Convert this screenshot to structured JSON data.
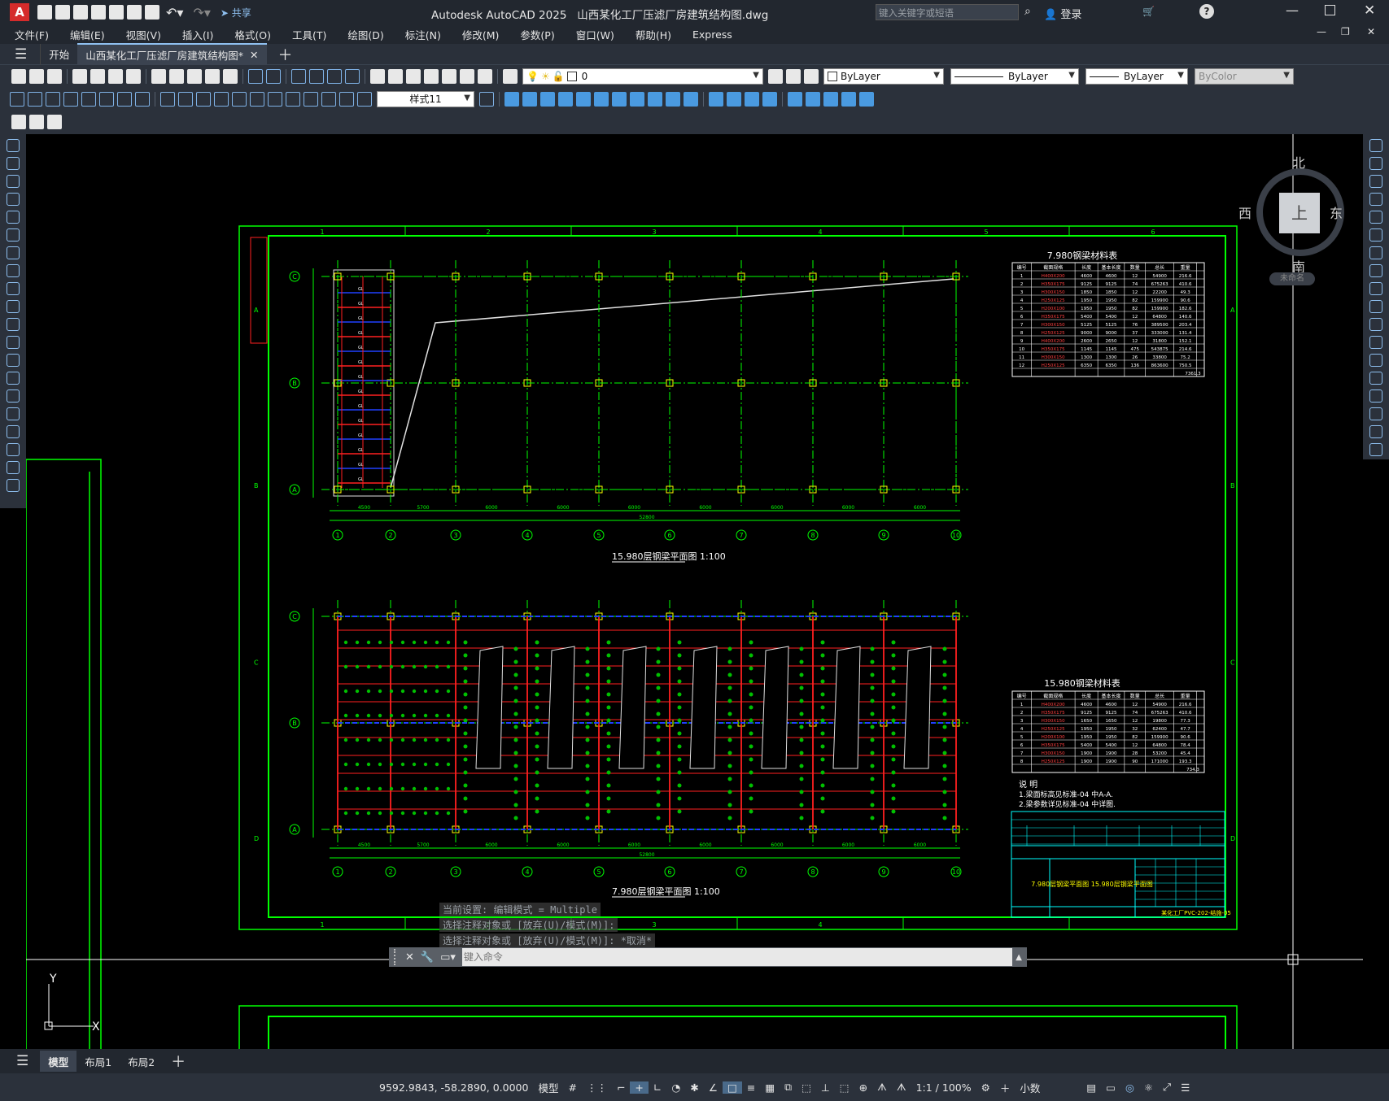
{
  "title_bar": {
    "app_name": "Autodesk AutoCAD 2025",
    "file_name": "山西某化工厂压滤厂房建筑结构图.dwg",
    "share_label": "共享",
    "search_placeholder": "键入关键字或短语",
    "login_label": "登录"
  },
  "menu": [
    "文件(F)",
    "编辑(E)",
    "视图(V)",
    "插入(I)",
    "格式(O)",
    "工具(T)",
    "绘图(D)",
    "标注(N)",
    "修改(M)",
    "参数(P)",
    "窗口(W)",
    "帮助(H)",
    "Express"
  ],
  "file_tabs": {
    "home": "开始",
    "active": "山西某化工厂压滤厂房建筑结构图*"
  },
  "layer": {
    "current": "0"
  },
  "properties": {
    "color": "ByLayer",
    "linetype": "ByLayer",
    "lineweight": "ByLayer",
    "plotstyle": "ByColor"
  },
  "dim_style": "样式11",
  "viewcube": {
    "north": "北",
    "south": "南",
    "east": "东",
    "west": "西",
    "top": "上",
    "wcs": "未命名"
  },
  "drawing": {
    "plan_top_title": "15.980层钢梁平面图",
    "plan_top_scale": "1:100",
    "plan_bottom_title": "7.980层钢梁平面图",
    "plan_bottom_scale": "1:100",
    "table1_title": "7.980钢梁材料表",
    "table2_title": "15.980钢梁材料表",
    "notes_heading": "说 明",
    "note1": "1.梁面标高见标准-04 中A-A.",
    "note2": "2.梁参数详见标准-04 中详图.",
    "grid_numbers": [
      "1",
      "2",
      "3",
      "4",
      "5",
      "6",
      "7",
      "8",
      "9",
      "10"
    ],
    "grid_letters": [
      "C",
      "B",
      "A"
    ],
    "frame_numbers": [
      "1",
      "2",
      "3",
      "4",
      "5",
      "6"
    ],
    "frame_letters": [
      "A",
      "B",
      "C",
      "D"
    ],
    "total_dim": "52800",
    "span_dims": [
      "4500",
      "5700",
      "6000",
      "6000",
      "6000",
      "6000",
      "6000",
      "6000",
      "6000"
    ],
    "table_headers": [
      "编号",
      "截面规格",
      "长度",
      "基本长度",
      "数量",
      "总长",
      "重量"
    ],
    "table1_rows": [
      [
        "1",
        "H400X200",
        "4600",
        "4600",
        "12",
        "54900",
        "216.6"
      ],
      [
        "2",
        "H350X175",
        "9125",
        "9125",
        "74",
        "675263",
        "410.6"
      ],
      [
        "3",
        "H300X150",
        "1850",
        "1850",
        "12",
        "22200",
        "49.3"
      ],
      [
        "4",
        "H250X125",
        "1950",
        "1950",
        "82",
        "159900",
        "90.6"
      ],
      [
        "5",
        "H200X100",
        "1950",
        "1950",
        "82",
        "159900",
        "182.6"
      ],
      [
        "6",
        "H350X175",
        "5400",
        "5400",
        "12",
        "64800",
        "140.6"
      ],
      [
        "7",
        "H300X150",
        "5125",
        "5125",
        "76",
        "389500",
        "203.4"
      ],
      [
        "8",
        "H250X125",
        "9000",
        "9000",
        "37",
        "333000",
        "131.4"
      ],
      [
        "9",
        "H400X200",
        "2600",
        "2650",
        "12",
        "31800",
        "152.1"
      ],
      [
        "10",
        "H350X175",
        "1145",
        "1145",
        "475",
        "543875",
        "214.6"
      ],
      [
        "11",
        "H300X150",
        "1300",
        "1300",
        "26",
        "33800",
        "75.2"
      ],
      [
        "12",
        "H250X125",
        "6350",
        "6350",
        "136",
        "863600",
        "750.5"
      ]
    ],
    "table2_rows": [
      [
        "1",
        "H400X200",
        "4600",
        "4600",
        "12",
        "54900",
        "216.6"
      ],
      [
        "2",
        "H350X175",
        "9125",
        "9125",
        "74",
        "675263",
        "410.6"
      ],
      [
        "3",
        "H300X150",
        "1650",
        "1650",
        "12",
        "19800",
        "77.3"
      ],
      [
        "4",
        "H250X125",
        "1950",
        "1950",
        "32",
        "62400",
        "47.7"
      ],
      [
        "5",
        "H200X100",
        "1950",
        "1950",
        "82",
        "159900",
        "90.6"
      ],
      [
        "6",
        "H350X175",
        "5400",
        "5400",
        "12",
        "64800",
        "78.4"
      ],
      [
        "7",
        "H300X150",
        "1900",
        "1900",
        "28",
        "53200",
        "45.4"
      ],
      [
        "8",
        "H250X125",
        "1900",
        "1900",
        "90",
        "171000",
        "193.3"
      ]
    ],
    "table1_total": "7361.3",
    "table2_total": "734.3",
    "titleblock_drawing_name": "7.980层钢梁平面图 15.980层钢梁平面图",
    "titleblock_number": "某化工厂PVC-202-结施-05"
  },
  "command_history": [
    "当前设置: 编辑模式 = Multiple",
    "选择注释对象或 [放弃(U)/模式(M)]:",
    "选择注释对象或 [放弃(U)/模式(M)]: *取消*"
  ],
  "command_placeholder": "键入命令",
  "layout_tabs": [
    "模型",
    "布局1",
    "布局2"
  ],
  "status": {
    "coords": "9592.9843, -58.2890, 0.0000",
    "model": "模型",
    "scale": "1:1 / 100%",
    "units": "小数"
  },
  "colors": {
    "frame": "#00ff00",
    "beam": "#ff2020",
    "grid": "#00ff00",
    "axis": "#00ffff",
    "blue": "#2040ff",
    "panel": "#2b313b"
  }
}
